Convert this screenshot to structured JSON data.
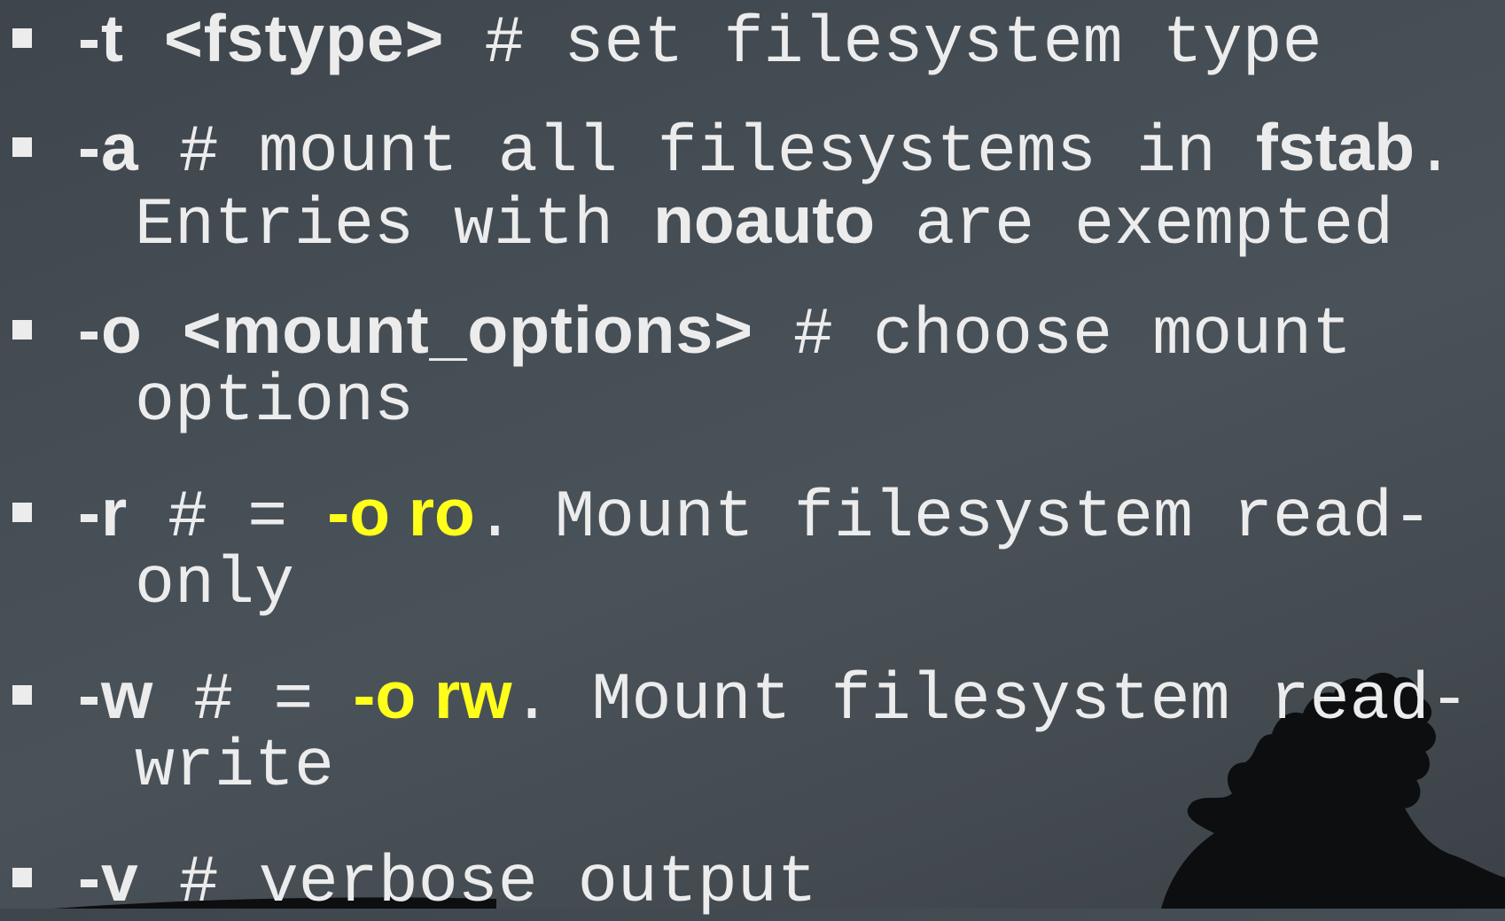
{
  "bullets": [
    {
      "option": "-t",
      "arg": "<fstype>",
      "comment": "# set filesystem type"
    },
    {
      "option": "-a",
      "comment_pre": "# mount all filesystems in ",
      "keyword": "fstab",
      "comment_post": ".",
      "line2_pre": "Entries with ",
      "line2_keyword": "noauto",
      "line2_post": " are exempted"
    },
    {
      "option": "-o",
      "arg": "<mount_options>",
      "comment": "# choose mount",
      "line2": "options"
    },
    {
      "option": "-r",
      "comment_pre": "# = ",
      "highlight": "-o ro",
      "comment_post": ". Mount filesystem read-",
      "line2": "only"
    },
    {
      "option": "-w",
      "comment_pre": "# = ",
      "highlight": "-o rw",
      "comment_post": ". Mount filesystem read-",
      "line2": "write"
    },
    {
      "option": "-v",
      "comment": "# verbose output"
    }
  ],
  "colors": {
    "text": "#ececec",
    "highlight": "#ffff1a",
    "background": "#454d54"
  }
}
